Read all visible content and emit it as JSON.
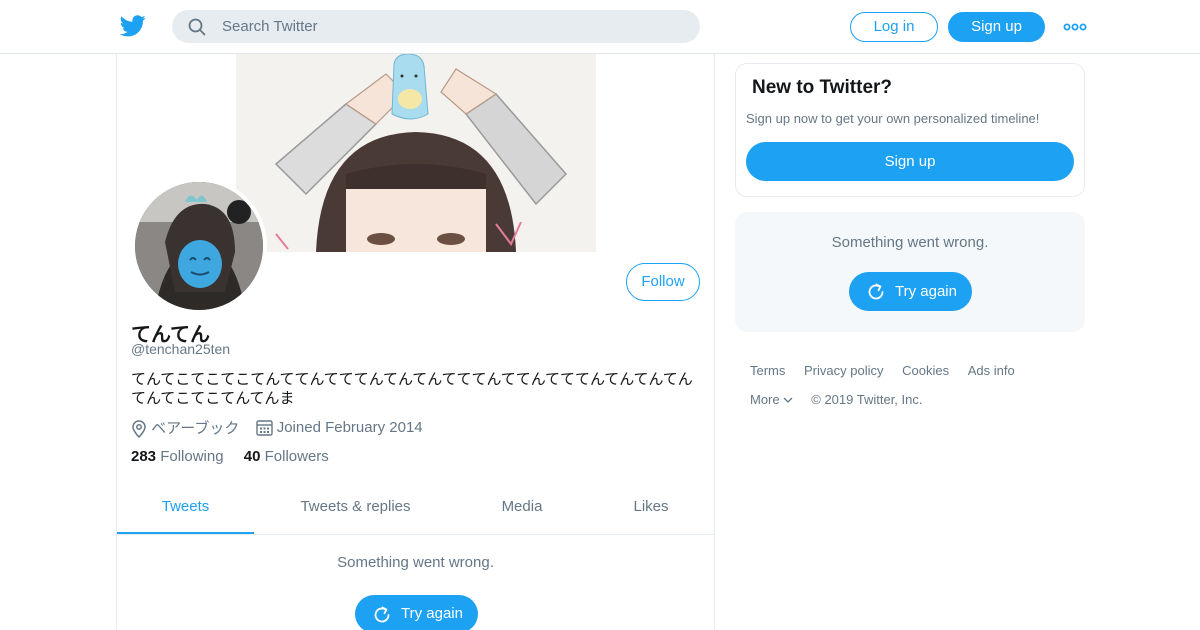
{
  "header": {
    "search_placeholder": "Search Twitter",
    "login_label": "Log in",
    "signup_label": "Sign up",
    "logo_icon": "twitter-bird-icon",
    "more_icon": "more-dots-icon"
  },
  "profile": {
    "name": "てんてん",
    "handle": "@tenchan25ten",
    "bio": "てんてこてこてこてんててんてててんてんてんてててんててんてててんてんてんてんてんてこてこてんてんま",
    "location": "ベアーブック",
    "joined": "Joined February 2014",
    "follow_label": "Follow",
    "following_count": "283",
    "following_label": "Following",
    "followers_count": "40",
    "followers_label": "Followers"
  },
  "tabs": [
    {
      "label": "Tweets",
      "active": true
    },
    {
      "label": "Tweets & replies",
      "active": false
    },
    {
      "label": "Media",
      "active": false
    },
    {
      "label": "Likes",
      "active": false
    }
  ],
  "timeline": {
    "error": "Something went wrong.",
    "retry": "Try again"
  },
  "sidebar": {
    "new_title": "New to Twitter?",
    "new_subtitle": "Sign up now to get your own personalized timeline!",
    "signup_label": "Sign up",
    "error": "Something went wrong.",
    "retry": "Try again"
  },
  "footer": {
    "links": [
      "Terms",
      "Privacy policy",
      "Cookies",
      "Ads info"
    ],
    "more": "More",
    "copyright": "© 2019 Twitter, Inc."
  },
  "colors": {
    "accent": "#1da1f2",
    "secondary_text": "#657786",
    "border": "#e6ecf0"
  }
}
